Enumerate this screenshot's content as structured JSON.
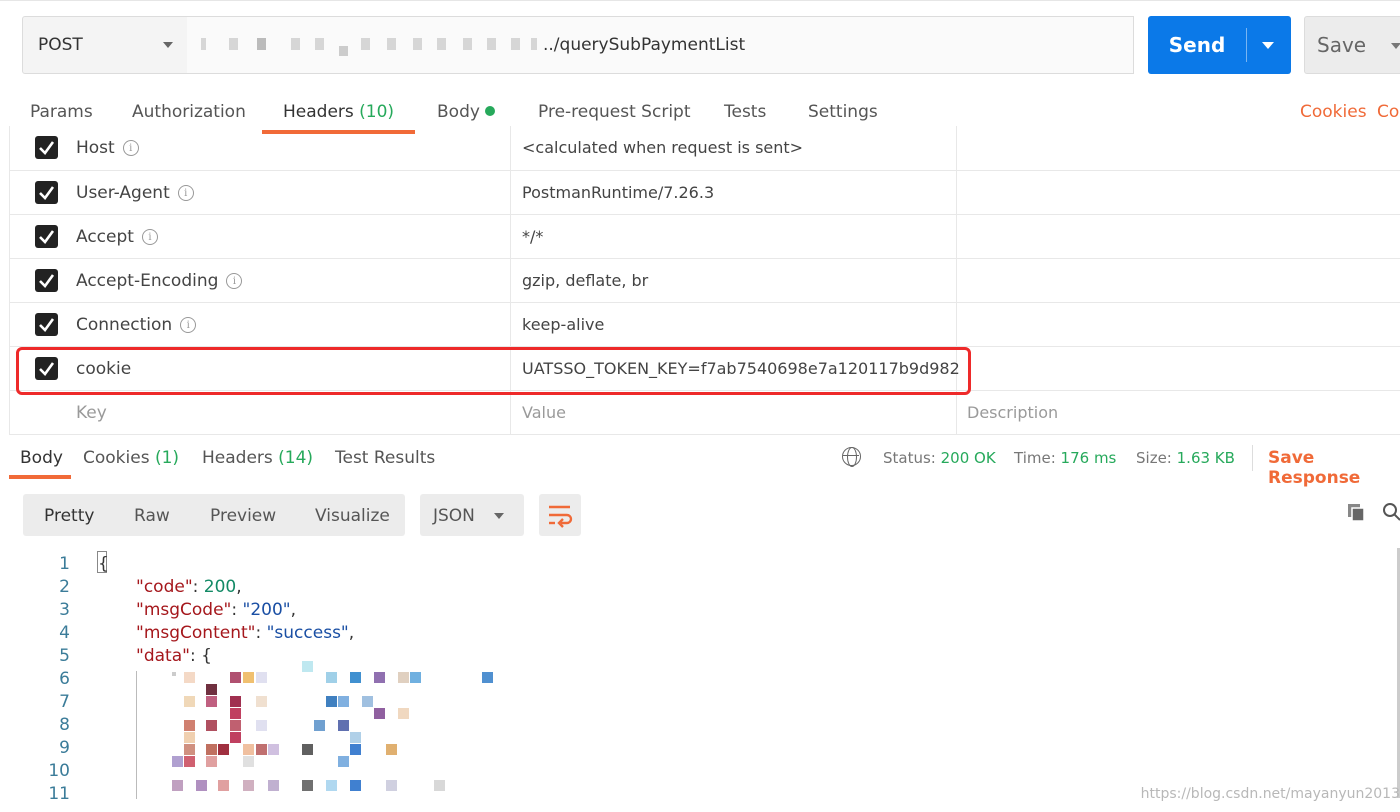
{
  "request": {
    "method": "POST",
    "url_visible": "../querySubPaymentList",
    "send_label": "Send",
    "save_label": "Save"
  },
  "request_tabs": [
    {
      "label": "Params"
    },
    {
      "label": "Authorization"
    },
    {
      "label": "Headers",
      "count": "(10)"
    },
    {
      "label": "Body"
    },
    {
      "label": "Pre-request Script"
    },
    {
      "label": "Tests"
    },
    {
      "label": "Settings"
    }
  ],
  "cookies_link": "Cookies",
  "code_link": "Co",
  "headers": [
    {
      "key": "Host",
      "value": "<calculated when request is sent>"
    },
    {
      "key": "User-Agent",
      "value": "PostmanRuntime/7.26.3"
    },
    {
      "key": "Accept",
      "value": "*/*"
    },
    {
      "key": "Accept-Encoding",
      "value": "gzip, deflate, br"
    },
    {
      "key": "Connection",
      "value": "keep-alive"
    },
    {
      "key": "cookie",
      "value": "UATSSO_TOKEN_KEY=f7ab7540698e7a120117b9d982"
    }
  ],
  "placeholders": {
    "key": "Key",
    "value": "Value",
    "description": "Description"
  },
  "response_tabs": [
    {
      "label": "Body"
    },
    {
      "label": "Cookies",
      "count": "(1)"
    },
    {
      "label": "Headers",
      "count": "(14)"
    },
    {
      "label": "Test Results"
    }
  ],
  "status": {
    "status_label": "Status:",
    "status_value": "200 OK",
    "time_label": "Time:",
    "time_value": "176 ms",
    "size_label": "Size:",
    "size_value": "1.63 KB"
  },
  "save_response": "Save Response",
  "view_modes": [
    "Pretty",
    "Raw",
    "Preview",
    "Visualize"
  ],
  "format": "JSON",
  "code_lines": {
    "l1": "{",
    "code_key": "\"code\"",
    "code_val": "200",
    "msgcode_key": "\"msgCode\"",
    "msgcode_val": "\"200\"",
    "msgcontent_key": "\"msgContent\"",
    "msgcontent_val": "\"success\"",
    "data_key": "\"data\"",
    "data_open": "{"
  },
  "line_numbers": [
    "1",
    "2",
    "3",
    "4",
    "5",
    "6",
    "7",
    "8",
    "9",
    "10",
    "11"
  ],
  "watermark": "https://blog.csdn.net/mayanyun2013",
  "colors": {
    "send": "#0b79e8",
    "accent": "#f16a38",
    "green": "#26a95b"
  }
}
